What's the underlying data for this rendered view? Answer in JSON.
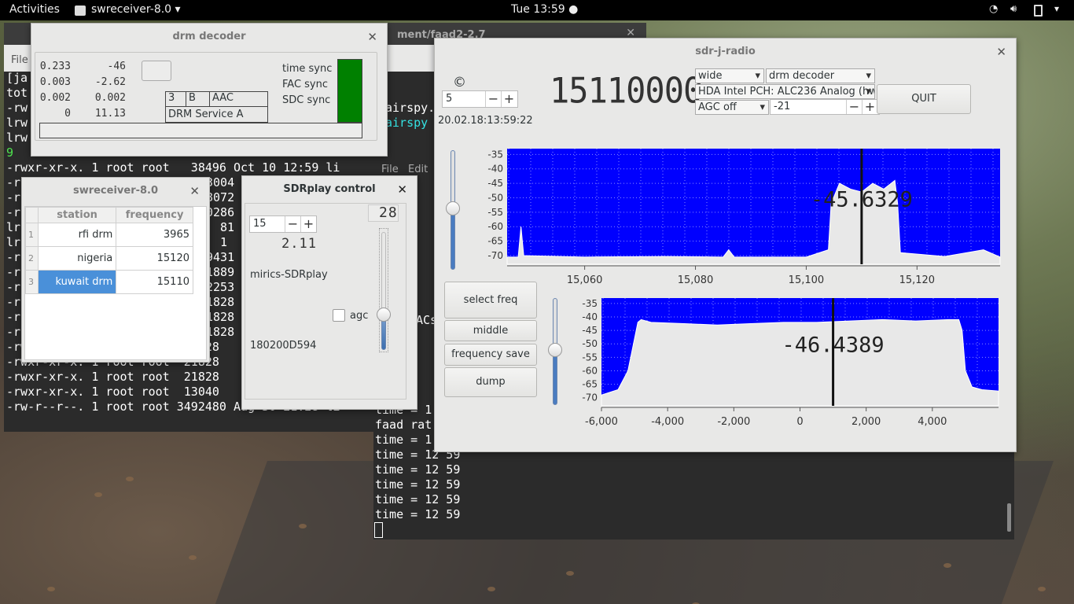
{
  "topbar": {
    "activities": "Activities",
    "app_name": "swreceiver-8.0",
    "clock": "Tue 13:59"
  },
  "term_bg": {
    "title_fragment": "ment/faad2-2.7",
    "menu_file": "File",
    "lines": [
      {
        "a": "[ja",
        "b": ""
      },
      {
        "a": "tot",
        "b": ""
      },
      {
        "a": "-rw",
        "b": "airspy."
      },
      {
        "a": "lrw",
        "b": "airspy"
      },
      {
        "a": "lrw",
        "b": ""
      },
      {
        "a": "9",
        "b": ""
      },
      {
        "a": "-rwxr-xr-x. 1 root root   38496 Oct 10 12:59 li",
        "b": ""
      },
      {
        "a": "-r",
        "b": "3004"
      },
      {
        "a": "-r",
        "b": "8072"
      },
      {
        "a": "-r",
        "b": "0286"
      },
      {
        "a": "lr",
        "b": "81"
      },
      {
        "a": "lr",
        "b": "1"
      },
      {
        "a": "-r",
        "b": "9431"
      },
      {
        "a": "-r",
        "b": "1889"
      },
      {
        "a": "-r",
        "b": "2253"
      },
      {
        "a": "-r",
        "b": "1828"
      },
      {
        "a": "-r",
        "b": "1828"
      },
      {
        "a": "-r",
        "b": "1828"
      },
      {
        "a": "-rwxr-xr-x. 1 root root  21828",
        "b": ""
      },
      {
        "a": "-rwxr-xr-x. 1 root root  21828",
        "b": ""
      },
      {
        "a": "-rwxr-xr-x. 1 root root  21828",
        "b": ""
      },
      {
        "a": "-rwxr-xr-x. 1 root root  13040",
        "b": ""
      },
      {
        "a": "-rw-r--r--. 1 root root 3492480 Aug 30 21:28 li",
        "b": ""
      }
    ]
  },
  "term_fg": {
    "menu_file": "File",
    "menu_edit": "Edit",
    "acs_fragment": "ACs",
    "lines": [
      "time = 1",
      "faad rat",
      "time = 1",
      "time = 12 59",
      "time = 12 59",
      "time = 12 59",
      "time = 12 59",
      "time = 12 59"
    ]
  },
  "drm": {
    "title": "drm decoder",
    "values": [
      [
        "0.233",
        "-46"
      ],
      [
        "0.003",
        "-2.62"
      ],
      [
        "0.002",
        "0.002"
      ],
      [
        "0",
        "11.13"
      ]
    ],
    "mode_cells": [
      "3",
      "B",
      "AAC"
    ],
    "service": "DRM Service A",
    "sync_labels": [
      "time sync",
      "FAC sync",
      "SDC sync"
    ],
    "sync_color": "#008000"
  },
  "swreceiver": {
    "title": "swreceiver-8.0",
    "col_station": "station",
    "col_frequency": "frequency",
    "rows": [
      {
        "n": "1",
        "station": "rfi drm",
        "freq": "3965"
      },
      {
        "n": "2",
        "station": "nigeria",
        "freq": "15120"
      },
      {
        "n": "3",
        "station": "kuwait drm",
        "freq": "15110"
      }
    ],
    "selected_color": "#4a90d9"
  },
  "sdrplay": {
    "title": "SDRplay control",
    "spin_value": "15",
    "lcd_small": "2.11",
    "lcd_right": "28",
    "device": "mirics-SDRplay",
    "agc_label": "agc",
    "serial": "180200D594"
  },
  "sdrj": {
    "title": "sdr-j-radio",
    "copyright": "©",
    "spin_value": "5",
    "frequency": "15110000",
    "timestamp": "20.02.18:13:59:22",
    "combo_band": "wide",
    "combo_decoder": "drm decoder",
    "combo_sound": "HDA Intel PCH: ALC236 Analog (hw",
    "combo_agc": "AGC off",
    "agc_value": "-21",
    "quit": "QUIT",
    "btn_select_freq": "select freq",
    "btn_middle": "middle",
    "btn_freq_save": "frequency save",
    "btn_dump": "dump",
    "plot_color": "#0000ff"
  },
  "chart_data": [
    {
      "type": "area",
      "name": "spectrum-main",
      "y_ticks": [
        "-35",
        "-40",
        "-45",
        "-50",
        "-55",
        "-60",
        "-65",
        "-70"
      ],
      "x_ticks": [
        "15,060",
        "15,080",
        "15,100",
        "15,120"
      ],
      "x_tick_values": [
        15060,
        15080,
        15100,
        15120
      ],
      "xlim": [
        15046,
        15135
      ],
      "ylim": [
        -73,
        -33
      ],
      "marker_x": 15110,
      "marker_label": "-45.6329",
      "series": [
        {
          "x": [
            15046,
            15048,
            15048.5,
            15049,
            15060,
            15075,
            15085,
            15086,
            15087,
            15100,
            15104,
            15104.5,
            15106,
            15108,
            15110,
            15112,
            15114,
            15116,
            15116.5,
            15117,
            15125,
            15132,
            15135
          ],
          "y": [
            -70.5,
            -70.5,
            -60,
            -70,
            -70.5,
            -70.3,
            -70.5,
            -68,
            -70.5,
            -70.5,
            -68,
            -52,
            -45,
            -47,
            -48,
            -45,
            -47,
            -44,
            -52,
            -69,
            -70.3,
            -68,
            -70.5
          ]
        }
      ]
    },
    {
      "type": "area",
      "name": "spectrum-zoom",
      "y_ticks": [
        "-35",
        "-40",
        "-45",
        "-50",
        "-55",
        "-60",
        "-65",
        "-70"
      ],
      "x_ticks": [
        "-6,000",
        "-4,000",
        "-2,000",
        "0",
        "2,000",
        "4,000"
      ],
      "x_tick_values": [
        -6000,
        -4000,
        -2000,
        0,
        2000,
        4000
      ],
      "xlim": [
        -6000,
        6000
      ],
      "ylim": [
        -73,
        -33
      ],
      "marker_x": 1000,
      "marker_label": "-46.4389",
      "series": [
        {
          "x": [
            -6000,
            -5500,
            -5200,
            -5000,
            -4900,
            -4800,
            -4500,
            -3500,
            -2500,
            -1500,
            -500,
            500,
            1500,
            2500,
            3500,
            4500,
            4800,
            4900,
            5000,
            5200,
            5500,
            6000
          ],
          "y": [
            -69,
            -67,
            -60,
            -48,
            -42,
            -41,
            -42,
            -42.5,
            -43,
            -42.5,
            -42,
            -42,
            -41.5,
            -41,
            -41.5,
            -41,
            -41,
            -45,
            -60,
            -66,
            -67,
            -67.5
          ]
        }
      ]
    }
  ]
}
